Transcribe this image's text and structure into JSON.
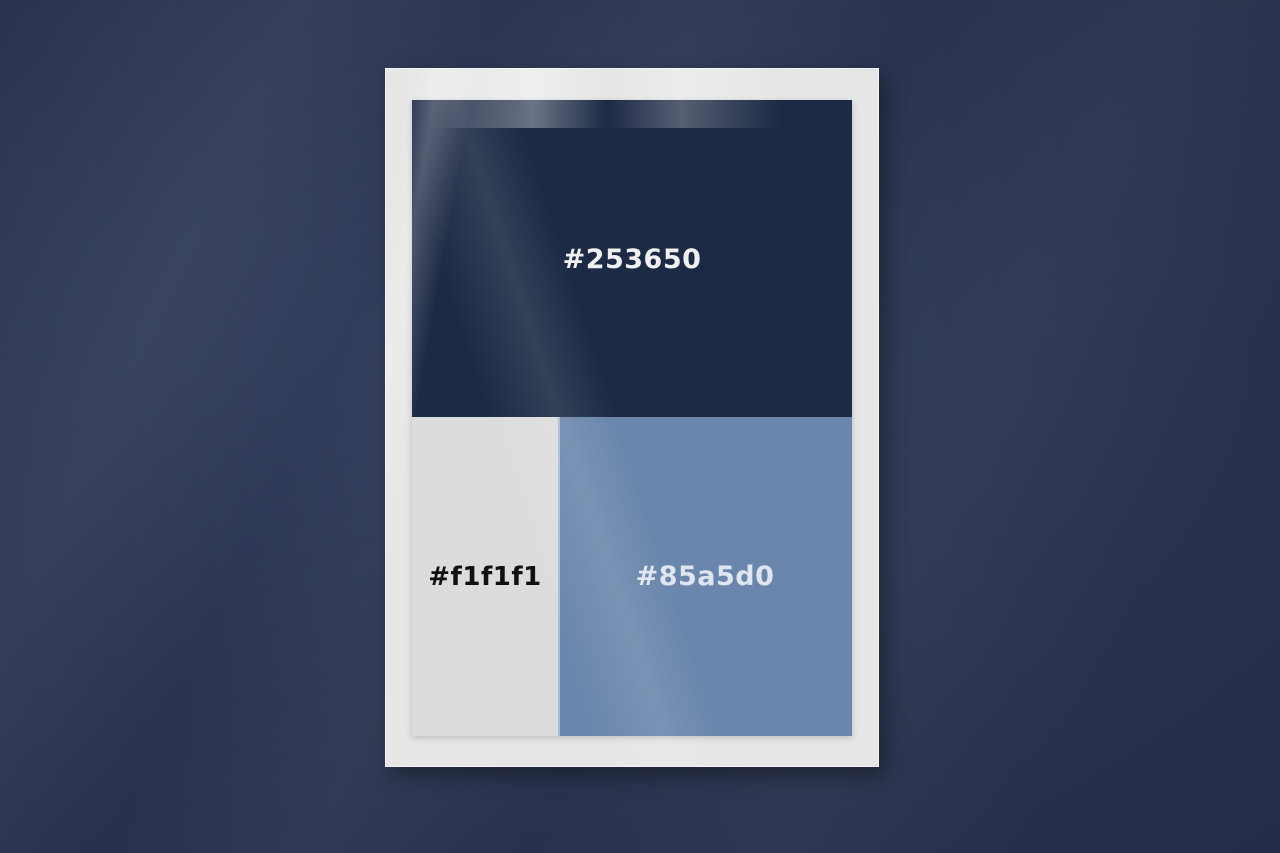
{
  "palette": {
    "swatches": [
      {
        "label": "#253650",
        "color": "#1d2a45"
      },
      {
        "label": "#f1f1f1",
        "color": "#dcdcdc"
      },
      {
        "label": "#85a5d0",
        "color": "#6a86ac"
      }
    ]
  }
}
